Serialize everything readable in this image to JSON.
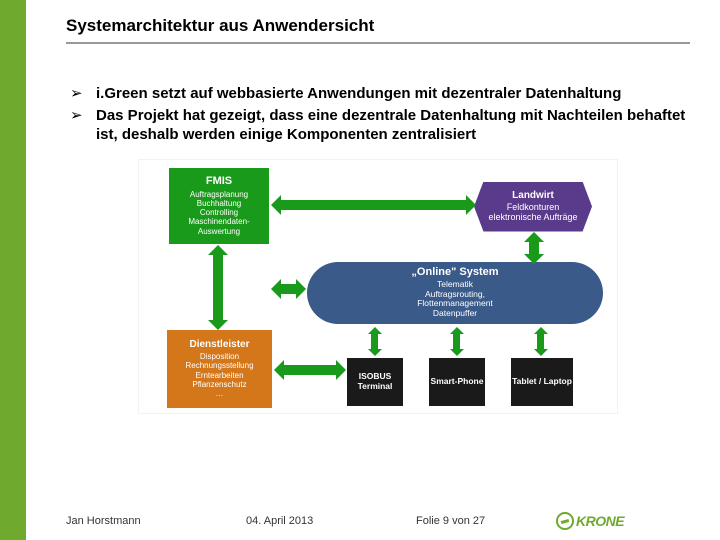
{
  "title": "Systemarchitektur aus Anwendersicht",
  "bullets": [
    "i.Green setzt auf webbasierte Anwendungen mit dezentraler Datenhaltung",
    "Das Projekt hat gezeigt, dass eine dezentrale Datenhaltung mit Nachteilen behaftet ist, deshalb werden einige Komponenten zentralisiert"
  ],
  "diagram": {
    "fmis": {
      "head": "FMIS",
      "lines": [
        "Auftragsplanung",
        "Buchhaltung",
        "Controlling",
        "Maschinendaten-",
        "Auswertung"
      ]
    },
    "landwirt": {
      "head": "Landwirt",
      "lines": [
        "Feldkonturen",
        "elektronische Aufträge"
      ]
    },
    "online": {
      "head": "„Online\" System",
      "lines": [
        "Telematik",
        "Auftragsrouting,",
        "Flottenmanagement",
        "Datenpuffer"
      ]
    },
    "dienst": {
      "head": "Dienstleister",
      "lines": [
        "Disposition",
        "Rechnungsstellung",
        "Erntearbeiten",
        "Pflanzenschutz",
        "…"
      ]
    },
    "terminals": [
      "ISOBUS Terminal",
      "Smart-Phone",
      "Tablet / Laptop"
    ]
  },
  "footer": {
    "author": "Jan Horstmann",
    "date": "04. April 2013",
    "page": "Folie 9 von 27",
    "brand": "KRONE"
  }
}
